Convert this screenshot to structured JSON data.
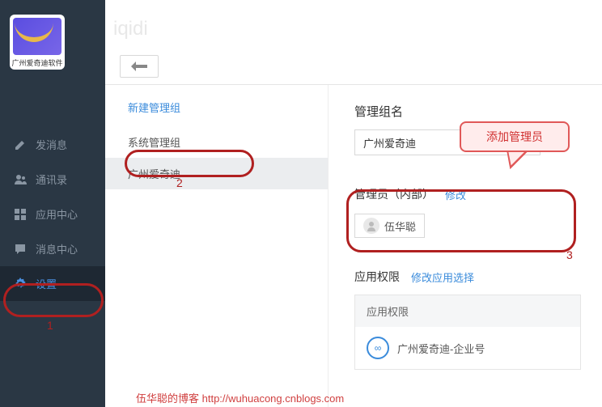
{
  "header": {
    "title": "iqidi"
  },
  "logo": {
    "text": "广州爱奇迪软件"
  },
  "sidebar": {
    "items": [
      {
        "label": "发消息",
        "icon": "edit-icon"
      },
      {
        "label": "通讯录",
        "icon": "contacts-icon"
      },
      {
        "label": "应用中心",
        "icon": "apps-icon"
      },
      {
        "label": "消息中心",
        "icon": "message-icon"
      },
      {
        "label": "设置",
        "icon": "gear-icon"
      }
    ]
  },
  "groups": {
    "new_label": "新建管理组",
    "items": [
      {
        "label": "系统管理组"
      },
      {
        "label": "广州爱奇迪"
      }
    ]
  },
  "detail": {
    "name_section_title": "管理组名",
    "name_value": "广州爱奇迪",
    "admin_title": "管理员（内部）",
    "modify_link": "修改",
    "admin_member": "伍华聪",
    "perm_title": "应用权限",
    "perm_modify_link": "修改应用选择",
    "perm_box_header": "应用权限",
    "perm_item": "广州爱奇迪-企业号"
  },
  "annotations": {
    "n1": "1",
    "n2": "2",
    "n3": "3",
    "callout": "添加管理员",
    "watermark": "伍华聪的博客 http://wuhuacong.cnblogs.com"
  }
}
